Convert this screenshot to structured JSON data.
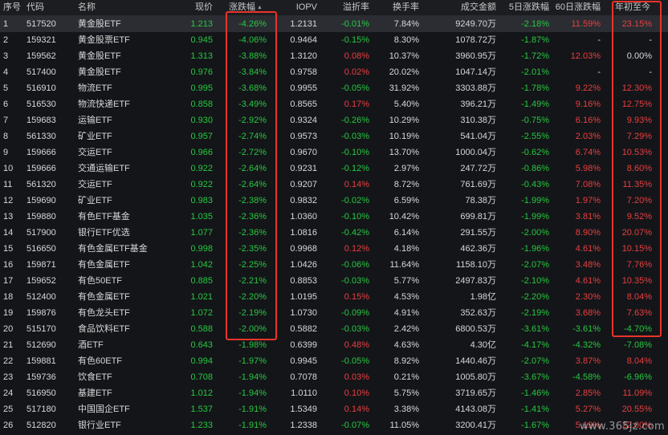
{
  "colors": {
    "up": "#e83f3f",
    "down": "#27c840",
    "neutral": "#d8d8d8",
    "highlight": "#e8342a"
  },
  "header": {
    "idx": "序号",
    "code": "代码",
    "name": "名称",
    "price": "现价",
    "change": "涨跌幅",
    "sort_glyph": "▲",
    "iopv": "IOPV",
    "premium": "溢折率",
    "turnover": "换手率",
    "amount": "成交金额",
    "d5": "5日涨跌幅",
    "d60": "60日涨跌幅",
    "ytd": "年初至今"
  },
  "rows": [
    {
      "idx": "1",
      "code": "517520",
      "name": "黄金股ETF",
      "price": "1.213",
      "change": "-4.26%",
      "iopv": "1.2131",
      "premium": "-0.01%",
      "turnover": "7.84%",
      "amount": "9249.70万",
      "d5": "-2.18%",
      "d60": "11.59%",
      "ytd": "23.15%"
    },
    {
      "idx": "2",
      "code": "159321",
      "name": "黄金股票ETF",
      "price": "0.945",
      "change": "-4.06%",
      "iopv": "0.9464",
      "premium": "-0.15%",
      "turnover": "8.30%",
      "amount": "1078.72万",
      "d5": "-1.87%",
      "d60": "-",
      "ytd": "-"
    },
    {
      "idx": "3",
      "code": "159562",
      "name": "黄金股ETF",
      "price": "1.313",
      "change": "-3.88%",
      "iopv": "1.3120",
      "premium": "0.08%",
      "turnover": "10.37%",
      "amount": "3960.95万",
      "d5": "-1.72%",
      "d60": "12.03%",
      "ytd": "0.00%"
    },
    {
      "idx": "4",
      "code": "517400",
      "name": "黄金股ETF",
      "price": "0.976",
      "change": "-3.84%",
      "iopv": "0.9758",
      "premium": "0.02%",
      "turnover": "20.02%",
      "amount": "1047.14万",
      "d5": "-2.01%",
      "d60": "-",
      "ytd": "-"
    },
    {
      "idx": "5",
      "code": "516910",
      "name": "物流ETF",
      "price": "0.995",
      "change": "-3.68%",
      "iopv": "0.9955",
      "premium": "-0.05%",
      "turnover": "31.92%",
      "amount": "3303.88万",
      "d5": "-1.78%",
      "d60": "9.22%",
      "ytd": "12.30%"
    },
    {
      "idx": "6",
      "code": "516530",
      "name": "物流快递ETF",
      "price": "0.858",
      "change": "-3.49%",
      "iopv": "0.8565",
      "premium": "0.17%",
      "turnover": "5.40%",
      "amount": "396.21万",
      "d5": "-1.49%",
      "d60": "9.16%",
      "ytd": "12.75%"
    },
    {
      "idx": "7",
      "code": "159683",
      "name": "运输ETF",
      "price": "0.930",
      "change": "-2.92%",
      "iopv": "0.9324",
      "premium": "-0.26%",
      "turnover": "10.29%",
      "amount": "310.38万",
      "d5": "-0.75%",
      "d60": "6.16%",
      "ytd": "9.93%"
    },
    {
      "idx": "8",
      "code": "561330",
      "name": "矿业ETF",
      "price": "0.957",
      "change": "-2.74%",
      "iopv": "0.9573",
      "premium": "-0.03%",
      "turnover": "10.19%",
      "amount": "541.04万",
      "d5": "-2.55%",
      "d60": "2.03%",
      "ytd": "7.29%"
    },
    {
      "idx": "9",
      "code": "159666",
      "name": "交运ETF",
      "price": "0.966",
      "change": "-2.72%",
      "iopv": "0.9670",
      "premium": "-0.10%",
      "turnover": "13.70%",
      "amount": "1000.04万",
      "d5": "-0.62%",
      "d60": "6.74%",
      "ytd": "10.53%"
    },
    {
      "idx": "10",
      "code": "159666",
      "name": "交通运输ETF",
      "price": "0.922",
      "change": "-2.64%",
      "iopv": "0.9231",
      "premium": "-0.12%",
      "turnover": "2.97%",
      "amount": "247.72万",
      "d5": "-0.86%",
      "d60": "5.98%",
      "ytd": "8.60%"
    },
    {
      "idx": "11",
      "code": "561320",
      "name": "交运ETF",
      "price": "0.922",
      "change": "-2.64%",
      "iopv": "0.9207",
      "premium": "0.14%",
      "turnover": "8.72%",
      "amount": "761.69万",
      "d5": "-0.43%",
      "d60": "7.08%",
      "ytd": "11.35%"
    },
    {
      "idx": "12",
      "code": "159690",
      "name": "矿业ETF",
      "price": "0.983",
      "change": "-2.38%",
      "iopv": "0.9832",
      "premium": "-0.02%",
      "turnover": "6.59%",
      "amount": "78.38万",
      "d5": "-1.99%",
      "d60": "1.97%",
      "ytd": "7.20%"
    },
    {
      "idx": "13",
      "code": "159880",
      "name": "有色ETF基金",
      "price": "1.035",
      "change": "-2.36%",
      "iopv": "1.0360",
      "premium": "-0.10%",
      "turnover": "10.42%",
      "amount": "699.81万",
      "d5": "-1.99%",
      "d60": "3.81%",
      "ytd": "9.52%"
    },
    {
      "idx": "14",
      "code": "517900",
      "name": "银行ETF优选",
      "price": "1.077",
      "change": "-2.36%",
      "iopv": "1.0816",
      "premium": "-0.42%",
      "turnover": "6.14%",
      "amount": "291.55万",
      "d5": "-2.00%",
      "d60": "8.90%",
      "ytd": "20.07%"
    },
    {
      "idx": "15",
      "code": "516650",
      "name": "有色金属ETF基金",
      "price": "0.998",
      "change": "-2.35%",
      "iopv": "0.9968",
      "premium": "0.12%",
      "turnover": "4.18%",
      "amount": "462.36万",
      "d5": "-1.96%",
      "d60": "4.61%",
      "ytd": "10.15%"
    },
    {
      "idx": "16",
      "code": "159871",
      "name": "有色金属ETF",
      "price": "1.042",
      "change": "-2.25%",
      "iopv": "1.0426",
      "premium": "-0.06%",
      "turnover": "11.64%",
      "amount": "1158.10万",
      "d5": "-2.07%",
      "d60": "3.48%",
      "ytd": "7.76%"
    },
    {
      "idx": "17",
      "code": "159652",
      "name": "有色50ETF",
      "price": "0.885",
      "change": "-2.21%",
      "iopv": "0.8853",
      "premium": "-0.03%",
      "turnover": "5.77%",
      "amount": "2497.83万",
      "d5": "-2.10%",
      "d60": "4.61%",
      "ytd": "10.35%"
    },
    {
      "idx": "18",
      "code": "512400",
      "name": "有色金属ETF",
      "price": "1.021",
      "change": "-2.20%",
      "iopv": "1.0195",
      "premium": "0.15%",
      "turnover": "4.53%",
      "amount": "1.98亿",
      "d5": "-2.20%",
      "d60": "2.30%",
      "ytd": "8.04%"
    },
    {
      "idx": "19",
      "code": "159876",
      "name": "有色龙头ETF",
      "price": "1.072",
      "change": "-2.19%",
      "iopv": "1.0730",
      "premium": "-0.09%",
      "turnover": "4.91%",
      "amount": "352.63万",
      "d5": "-2.19%",
      "d60": "3.68%",
      "ytd": "7.63%"
    },
    {
      "idx": "20",
      "code": "515170",
      "name": "食品饮料ETF",
      "price": "0.588",
      "change": "-2.00%",
      "iopv": "0.5882",
      "premium": "-0.03%",
      "turnover": "2.42%",
      "amount": "6800.53万",
      "d5": "-3.61%",
      "d60": "-3.61%",
      "ytd": "-4.70%"
    },
    {
      "idx": "21",
      "code": "512690",
      "name": "酒ETF",
      "price": "0.643",
      "change": "-1.98%",
      "iopv": "0.6399",
      "premium": "0.48%",
      "turnover": "4.63%",
      "amount": "4.30亿",
      "d5": "-4.17%",
      "d60": "-4.32%",
      "ytd": "-7.08%"
    },
    {
      "idx": "22",
      "code": "159881",
      "name": "有色60ETF",
      "price": "0.994",
      "change": "-1.97%",
      "iopv": "0.9945",
      "premium": "-0.05%",
      "turnover": "8.92%",
      "amount": "1440.46万",
      "d5": "-2.07%",
      "d60": "3.87%",
      "ytd": "8.04%"
    },
    {
      "idx": "23",
      "code": "159736",
      "name": "饮食ETF",
      "price": "0.708",
      "change": "-1.94%",
      "iopv": "0.7078",
      "premium": "0.03%",
      "turnover": "0.21%",
      "amount": "1005.80万",
      "d5": "-3.67%",
      "d60": "-4.58%",
      "ytd": "-6.96%"
    },
    {
      "idx": "24",
      "code": "516950",
      "name": "基建ETF",
      "price": "1.012",
      "change": "-1.94%",
      "iopv": "1.0110",
      "premium": "0.10%",
      "turnover": "5.75%",
      "amount": "3719.65万",
      "d5": "-1.46%",
      "d60": "2.85%",
      "ytd": "11.09%"
    },
    {
      "idx": "25",
      "code": "517180",
      "name": "中国国企ETF",
      "price": "1.537",
      "change": "-1.91%",
      "iopv": "1.5349",
      "premium": "0.14%",
      "turnover": "3.38%",
      "amount": "4143.08万",
      "d5": "-1.41%",
      "d60": "5.27%",
      "ytd": "20.55%"
    },
    {
      "idx": "26",
      "code": "512820",
      "name": "银行业ETF",
      "price": "1.233",
      "change": "-1.91%",
      "iopv": "1.2338",
      "premium": "-0.07%",
      "turnover": "11.05%",
      "amount": "3200.41万",
      "d5": "-1.67%",
      "d60": "5.19%",
      "ytd": "22.00%"
    }
  ],
  "watermark": "www.365jz.com"
}
